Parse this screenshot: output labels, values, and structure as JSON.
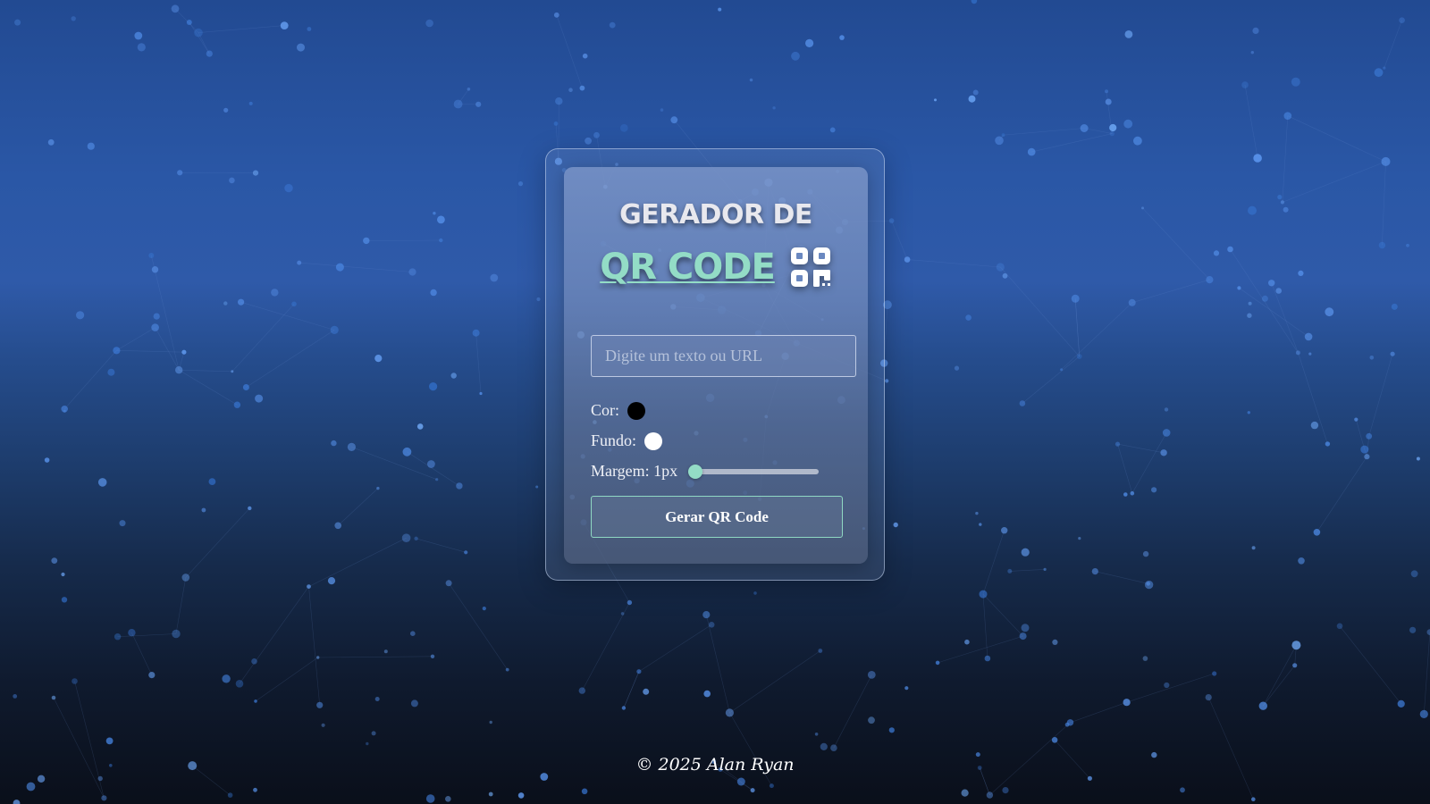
{
  "colors": {
    "accent": "#93dcc6",
    "swatch_color": "#000000",
    "swatch_background": "#ffffff"
  },
  "header": {
    "title_line1": "GERADOR DE",
    "title_line2": "QR CODE",
    "icon": "qr-code-icon"
  },
  "form": {
    "text_input": {
      "placeholder": "Digite um texto ou URL",
      "value": ""
    },
    "color_label": "Cor:",
    "background_label": "Fundo:",
    "margin_label": "Margem: 1px",
    "margin_value": 1,
    "generate_button": "Gerar QR Code"
  },
  "footer": {
    "text": "© 2025 Alan Ryan"
  }
}
